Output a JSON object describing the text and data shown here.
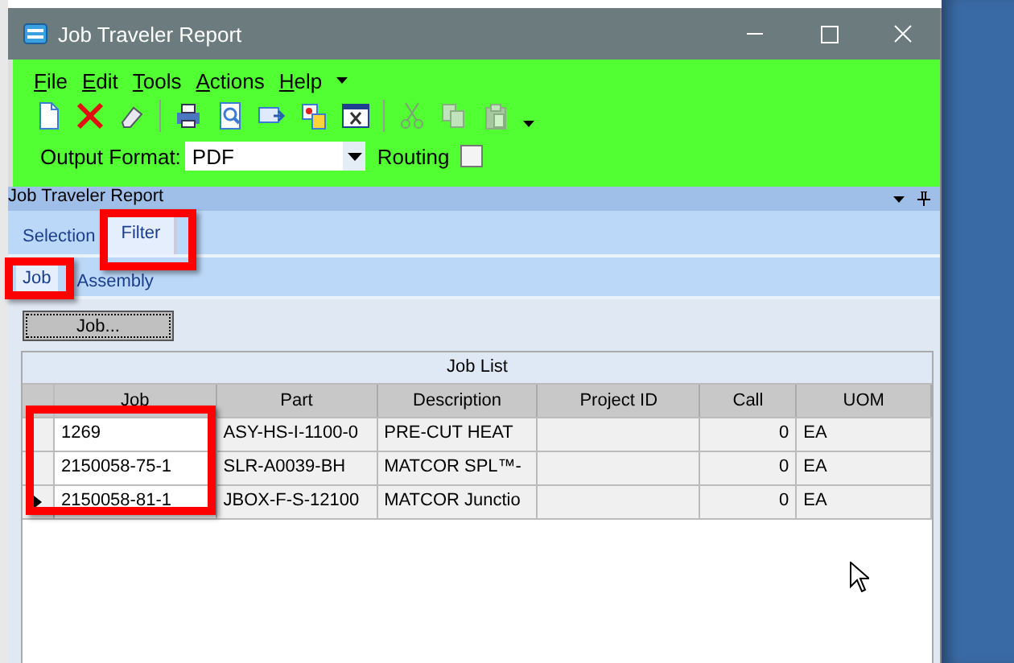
{
  "window": {
    "title": "Job Traveler Report"
  },
  "menu": [
    {
      "label": "File"
    },
    {
      "label": "Edit"
    },
    {
      "label": "Tools"
    },
    {
      "label": "Actions"
    },
    {
      "label": "Help"
    }
  ],
  "toolbar": [
    {
      "kind": "new",
      "disabled": false
    },
    {
      "kind": "delete",
      "disabled": false
    },
    {
      "kind": "clear",
      "disabled": false
    },
    {
      "kind": "sep"
    },
    {
      "kind": "print",
      "disabled": false
    },
    {
      "kind": "preview",
      "disabled": false
    },
    {
      "kind": "email",
      "disabled": false
    },
    {
      "kind": "schedule",
      "disabled": false
    },
    {
      "kind": "excel",
      "disabled": false
    },
    {
      "kind": "sep"
    },
    {
      "kind": "cut",
      "disabled": true
    },
    {
      "kind": "copy",
      "disabled": true
    },
    {
      "kind": "paste",
      "disabled": true
    }
  ],
  "output_format": {
    "label": "Output Format:",
    "value": "PDF"
  },
  "routing": {
    "label": "Routing",
    "checked": false
  },
  "panel": {
    "title": "Job Traveler Report"
  },
  "tabs": [
    {
      "label": "Selection",
      "selected": false
    },
    {
      "label": "Filter",
      "selected": true
    }
  ],
  "subtabs": [
    {
      "label": "Job",
      "selected": true
    },
    {
      "label": "Assembly",
      "selected": false
    }
  ],
  "job_button": "Job...",
  "grid": {
    "title": "Job List",
    "columns": [
      "Job",
      "Part",
      "Description",
      "Project ID",
      "Call",
      "UOM"
    ],
    "rows": [
      {
        "current": false,
        "cells": [
          "1269",
          "ASY-HS-I-1100-0",
          "PRE-CUT HEAT",
          "",
          "0",
          "EA"
        ]
      },
      {
        "current": false,
        "cells": [
          "2150058-75-1",
          "SLR-A0039-BH",
          "MATCOR SPL™-",
          "",
          "0",
          "EA"
        ]
      },
      {
        "current": true,
        "cells": [
          "2150058-81-1",
          "JBOX-F-S-12100",
          "MATCOR Junctio",
          "",
          "0",
          "EA"
        ]
      }
    ]
  }
}
